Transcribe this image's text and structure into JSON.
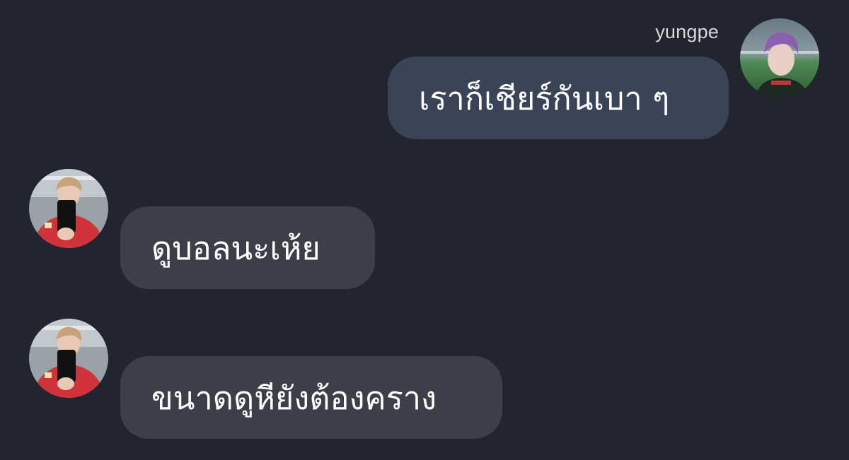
{
  "colors": {
    "background": "#22252d",
    "outgoing_bubble": "#3a4456",
    "incoming_bubble": "#3c3f48",
    "text": "#ffffff",
    "username": "#d6d8dd"
  },
  "chat": {
    "messages": [
      {
        "direction": "outgoing",
        "sender": "yungpe",
        "text": "เราก็เชียร์กันเบา ๆ",
        "avatar_icon": "user-avatar-icon"
      },
      {
        "direction": "incoming",
        "text": "ดูบอลนะเห้ย",
        "avatar_icon": "contact-avatar-icon"
      },
      {
        "direction": "incoming",
        "text": "ขนาดดูหียังต้องคราง",
        "avatar_icon": "contact-avatar-icon"
      }
    ]
  }
}
